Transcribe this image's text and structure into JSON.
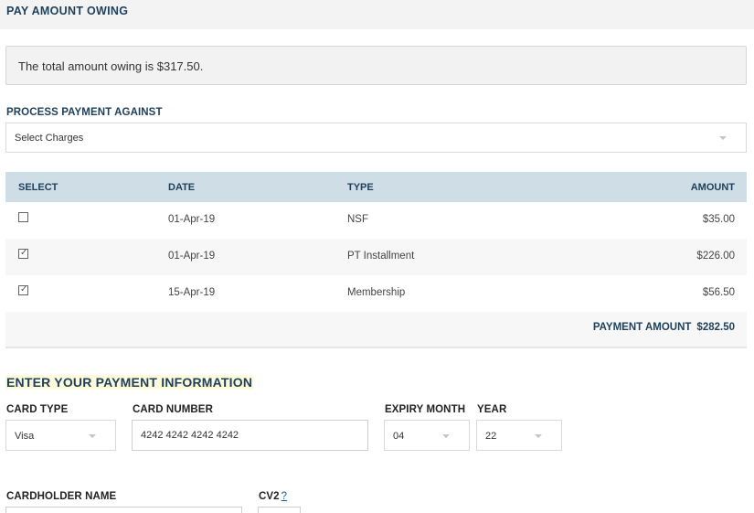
{
  "header": {
    "title": "PAY AMOUNT OWING"
  },
  "owing": {
    "message": "The total amount owing is $317.50."
  },
  "process": {
    "label": "PROCESS PAYMENT AGAINST",
    "selected": "Select Charges"
  },
  "table": {
    "columns": [
      "SELECT",
      "DATE",
      "TYPE",
      "AMOUNT"
    ],
    "rows": [
      {
        "checked": false,
        "date": "01-Apr-19",
        "type": "NSF",
        "amount": "$35.00"
      },
      {
        "checked": true,
        "date": "01-Apr-19",
        "type": "PT Installment",
        "amount": "$226.00"
      },
      {
        "checked": true,
        "date": "15-Apr-19",
        "type": "Membership",
        "amount": "$56.50"
      }
    ],
    "payment_label": "PAYMENT AMOUNT",
    "payment_value": "$282.50"
  },
  "payment_info": {
    "title": "ENTER YOUR PAYMENT INFORMATION",
    "card_type": {
      "label": "CARD TYPE",
      "value": "Visa"
    },
    "card_number": {
      "label": "CARD NUMBER",
      "value": "4242 4242 4242 4242"
    },
    "expiry_month": {
      "label": "EXPIRY MONTH",
      "value": "04"
    },
    "year": {
      "label": "YEAR",
      "value": "22"
    },
    "cardholder": {
      "label": "CARDHOLDER NAME",
      "value": ""
    },
    "cv2": {
      "label": "CV2",
      "help": "?",
      "value": ""
    }
  },
  "icons": {
    "dropdown": "chevron-down-icon",
    "checkbox": "checkbox-icon",
    "check": "check-icon"
  },
  "colors": {
    "heading": "#1e3f5a",
    "table_header_bg": "#cfdde6",
    "highlight": "#fdfadc"
  }
}
